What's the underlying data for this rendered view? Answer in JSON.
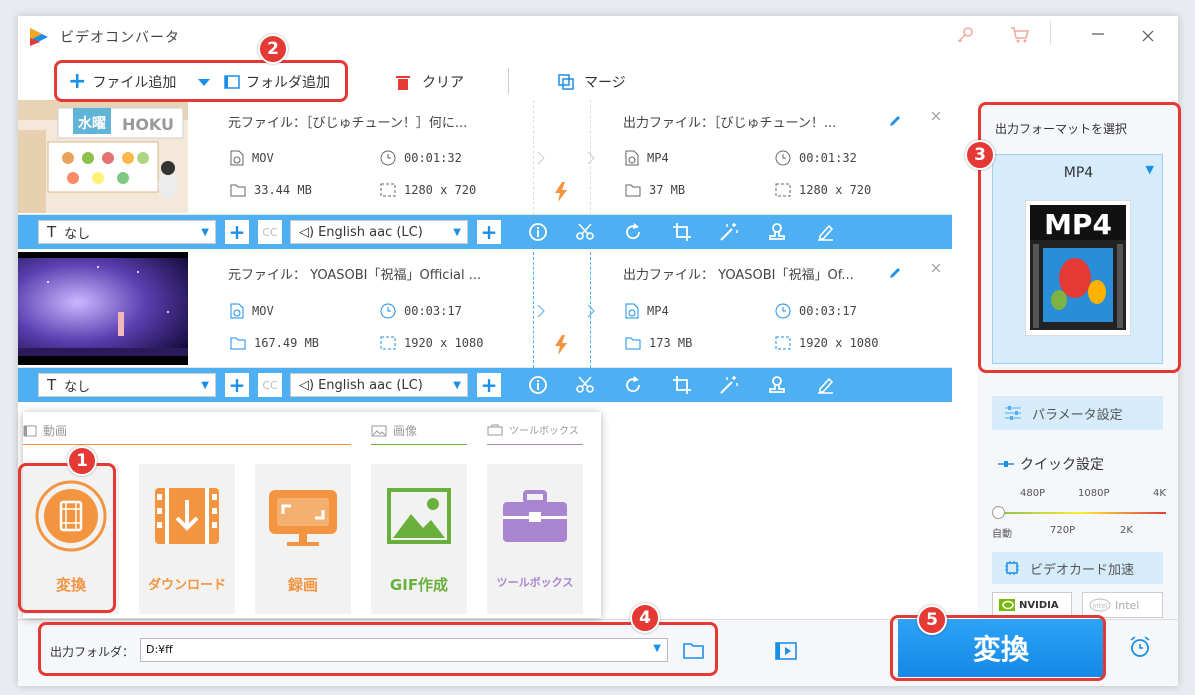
{
  "window": {
    "title": "ビデオコンバータ"
  },
  "toolbar": {
    "add_file": "ファイル追加",
    "add_folder": "フォルダ追加",
    "clear": "クリア",
    "merge": "マージ"
  },
  "files": [
    {
      "source_label": "元ファイル：［びじゅチューン！］何に...",
      "src_format": "MOV",
      "src_duration": "00:01:32",
      "src_size": "33.44 MB",
      "src_resolution": "1280 x 720",
      "output_label": "出力ファイル：［びじゅチューン！...",
      "out_format": "MP4",
      "out_duration": "00:01:32",
      "out_size": "37 MB",
      "out_resolution": "1280 x 720",
      "subtitle": "なし",
      "audio": "English aac (LC)"
    },
    {
      "source_label": "元ファイル： YOASOBI「祝福」Official ...",
      "src_format": "MOV",
      "src_duration": "00:03:17",
      "src_size": "167.49 MB",
      "src_resolution": "1920 x 1080",
      "output_label": "出力ファイル： YOASOBI「祝福」Of...",
      "out_format": "MP4",
      "out_duration": "00:03:17",
      "out_size": "173 MB",
      "out_resolution": "1920 x 1080",
      "subtitle": "なし",
      "audio": "English aac (LC)"
    }
  ],
  "right_panel": {
    "select_format_label": "出力フォーマットを選択",
    "format": "MP4",
    "format_icon_text": "MP4",
    "param_settings": "パラメータ設定",
    "quick_settings": "クイック設定",
    "quality_top": [
      "480P",
      "1080P",
      "4K"
    ],
    "quality_bottom": [
      "自動",
      "720P",
      "2K"
    ],
    "quality_level": 0,
    "gpu_accel": "ビデオカード加速",
    "nvidia": "NVIDIA",
    "intel": "Intel"
  },
  "launcher": {
    "video_section": "動画",
    "image_section": "画像",
    "toolbox_section": "ツールボックス",
    "tiles": [
      "変換",
      "ダウンロード",
      "録画",
      "GIF作成",
      "ツールボックス"
    ]
  },
  "bottom": {
    "output_folder_label": "出力フォルダ：",
    "output_folder_value": "D:¥ff",
    "convert_button": "変換"
  },
  "badges": [
    "1",
    "2",
    "3",
    "4",
    "5"
  ],
  "colors": {
    "accent": "#1a8fe8",
    "blue_bar": "#4eaff2",
    "orange": "#f29440",
    "green": "#6ab03c",
    "purple": "#a985d0",
    "red": "#e53935"
  }
}
